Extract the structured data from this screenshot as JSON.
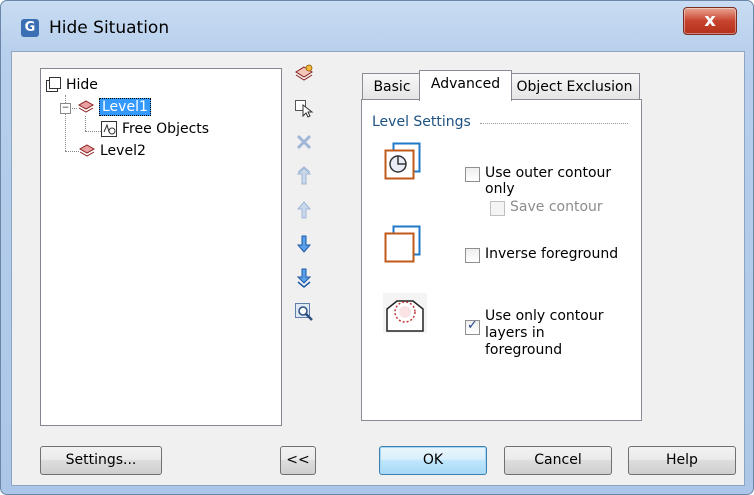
{
  "window": {
    "title": "Hide Situation",
    "close_label": "x",
    "colors": {
      "accent": "#3399ff",
      "close": "#c8432d"
    }
  },
  "tree": {
    "root": {
      "label": "Hide",
      "icon": "window-icon"
    },
    "items": [
      {
        "label": "Level1",
        "icon": "layers-icon",
        "selected": true,
        "expanded": true
      },
      {
        "label": "Free Objects",
        "icon": "free-objects-icon",
        "selected": false
      },
      {
        "label": "Level2",
        "icon": "layers-icon",
        "selected": false
      }
    ]
  },
  "toolbar": {
    "icons": [
      "add-level-icon",
      "select-objects-icon",
      "delete-icon",
      "move-top-icon",
      "move-up-icon",
      "move-down-icon",
      "move-bottom-icon",
      "zoom-icon"
    ]
  },
  "tabs": [
    {
      "label": "Basic",
      "active": false
    },
    {
      "label": "Advanced",
      "active": true
    },
    {
      "label": "Object Exclusion",
      "active": false
    }
  ],
  "level_settings": {
    "group_label": "Level Settings",
    "options": [
      {
        "label": "Use outer contour only",
        "checked": false,
        "enabled": true
      },
      {
        "label": "Save contour",
        "checked": false,
        "enabled": false
      },
      {
        "label": "Inverse foreground",
        "checked": false,
        "enabled": true
      },
      {
        "label_line1": "Use only contour layers in",
        "label_line2": "foreground",
        "checked": true,
        "enabled": true
      }
    ]
  },
  "buttons": {
    "settings": "Settings...",
    "collapse": "<<",
    "ok": "OK",
    "cancel": "Cancel",
    "help": "Help"
  }
}
